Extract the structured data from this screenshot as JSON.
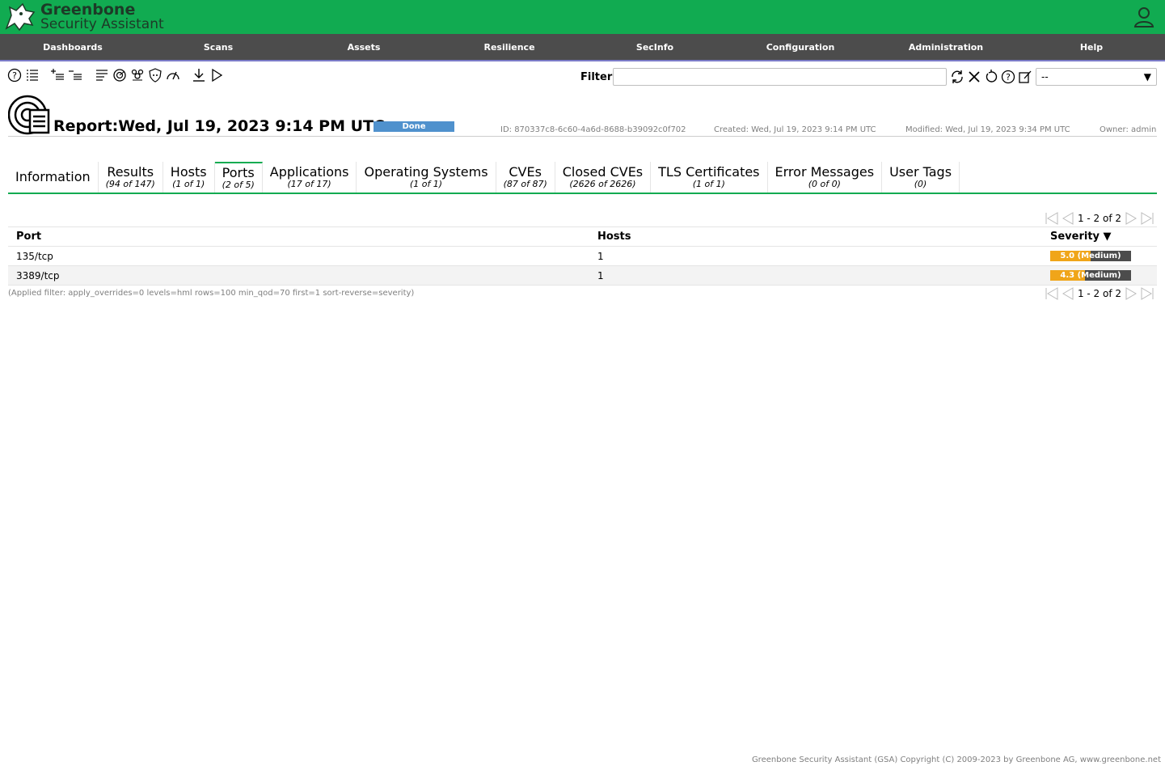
{
  "brand": {
    "line1": "Greenbone",
    "line2": "Security Assistant"
  },
  "nav": [
    {
      "label": "Dashboards"
    },
    {
      "label": "Scans"
    },
    {
      "label": "Assets"
    },
    {
      "label": "Resilience"
    },
    {
      "label": "SecInfo"
    },
    {
      "label": "Configuration"
    },
    {
      "label": "Administration"
    },
    {
      "label": "Help"
    }
  ],
  "filter": {
    "label": "Filter",
    "value": "",
    "select_value": "--"
  },
  "report": {
    "title": "Report:Wed, Jul 19, 2023 9:14 PM UTC",
    "status": "Done",
    "id": "ID: 870337c8-6c60-4a6d-8688-b39092c0f702",
    "created": "Created: Wed, Jul 19, 2023 9:14 PM UTC",
    "modified": "Modified: Wed, Jul 19, 2023 9:34 PM UTC",
    "owner": "Owner: admin"
  },
  "tabs": [
    {
      "label": "Information",
      "count": ""
    },
    {
      "label": "Results",
      "count": "(94 of 147)"
    },
    {
      "label": "Hosts",
      "count": "(1 of 1)"
    },
    {
      "label": "Ports",
      "count": "(2 of 5)"
    },
    {
      "label": "Applications",
      "count": "(17 of 17)"
    },
    {
      "label": "Operating Systems",
      "count": "(1 of 1)"
    },
    {
      "label": "CVEs",
      "count": "(87 of 87)"
    },
    {
      "label": "Closed CVEs",
      "count": "(2626 of 2626)"
    },
    {
      "label": "TLS Certificates",
      "count": "(1 of 1)"
    },
    {
      "label": "Error Messages",
      "count": "(0 of 0)"
    },
    {
      "label": "User Tags",
      "count": "(0)"
    }
  ],
  "pagination": {
    "text": "1 - 2 of 2"
  },
  "table": {
    "headers": {
      "port": "Port",
      "hosts": "Hosts",
      "severity": "Severity ▼"
    },
    "rows": [
      {
        "port": "135/tcp",
        "hosts": "1",
        "severity_label": "5.0 (Medium)",
        "severity_value": 5.0
      },
      {
        "port": "3389/tcp",
        "hosts": "1",
        "severity_label": "4.3 (Medium)",
        "severity_value": 4.3
      }
    ]
  },
  "applied_filter": "(Applied filter: apply_overrides=0 levels=hml rows=100 min_qod=70 first=1 sort-reverse=severity)",
  "footer": "Greenbone Security Assistant (GSA) Copyright (C) 2009-2023 by Greenbone AG, www.greenbone.net",
  "colors": {
    "brand_green": "#11ab51",
    "nav_bg": "#4c4c4c",
    "status_done": "#4f91cd",
    "severity_medium": "#f0a519"
  }
}
